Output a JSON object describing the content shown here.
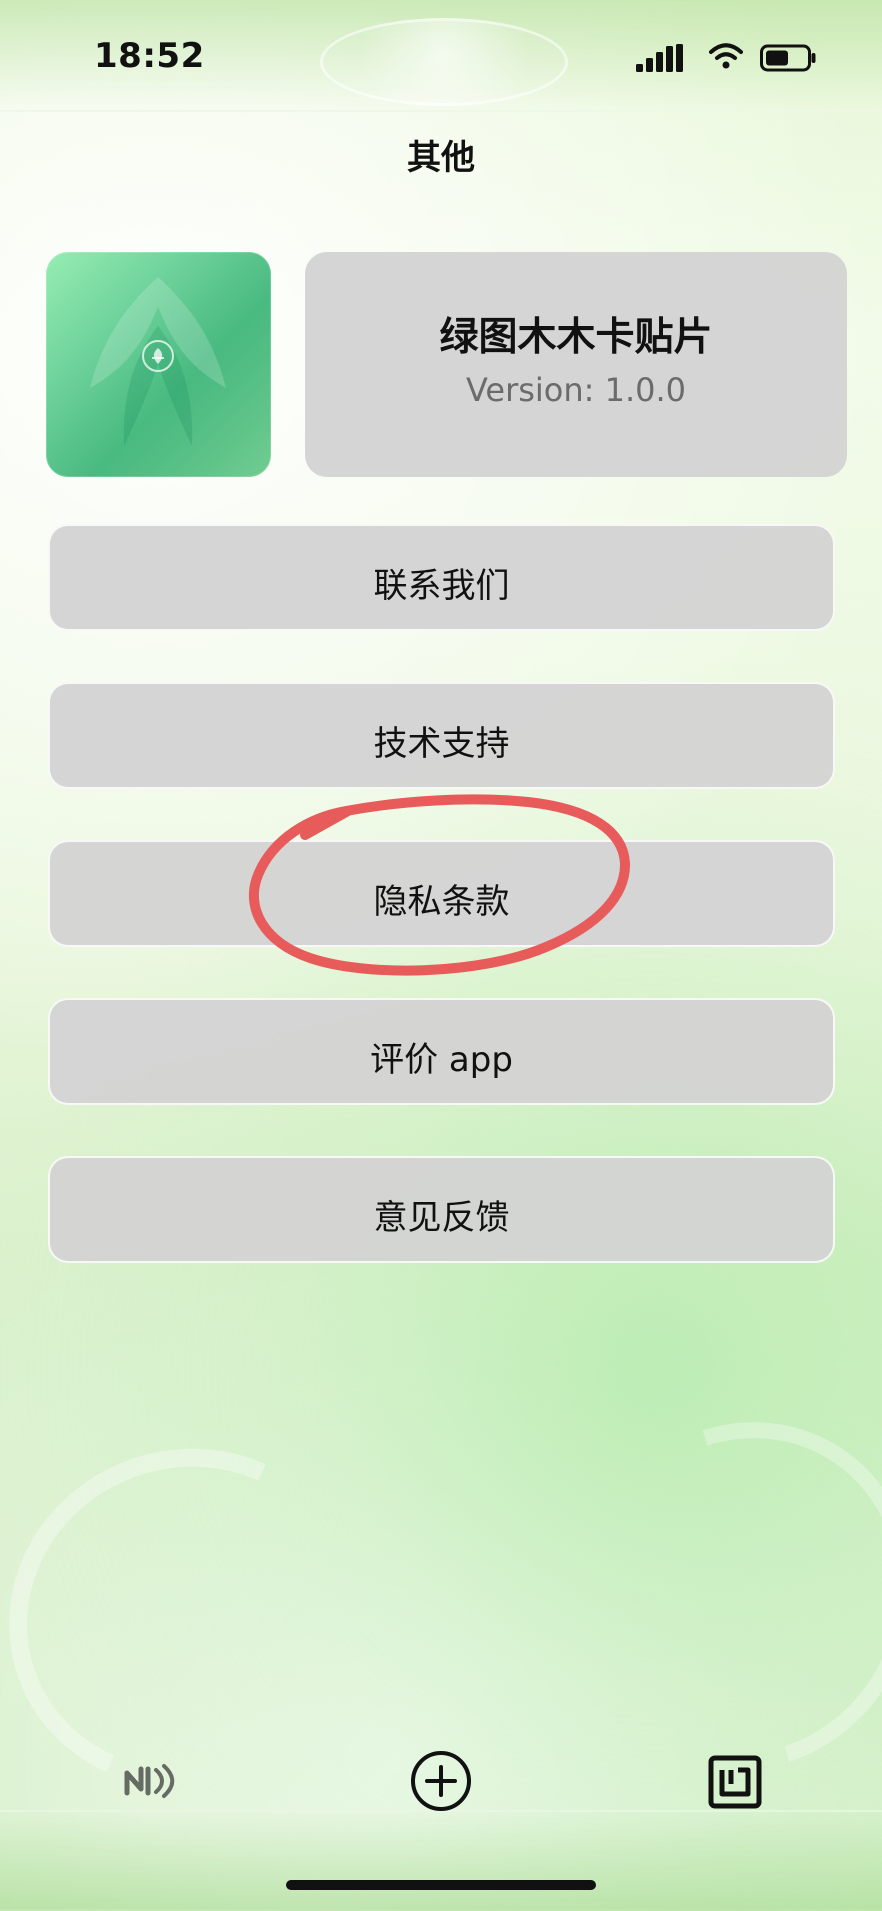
{
  "status_bar": {
    "time": "18:52",
    "icons": [
      "signal-icon",
      "wifi-icon",
      "battery-icon"
    ]
  },
  "navigation": {
    "title": "其他"
  },
  "app_info": {
    "icon_name": "app-logo",
    "name": "绿图木木卡贴片",
    "version": "Version: 1.0.0"
  },
  "menu": {
    "items": [
      {
        "label": "联系我们"
      },
      {
        "label": "技术支持"
      },
      {
        "label": "隐私条款",
        "highlighted": true
      },
      {
        "label": "评价 app"
      },
      {
        "label": "意见反馈"
      }
    ]
  },
  "toolbar": {
    "items": [
      {
        "icon": "nfc-icon"
      },
      {
        "icon": "add-circle-icon"
      },
      {
        "icon": "nfc-tag-icon"
      }
    ]
  },
  "colors": {
    "background": "#e8f7d8",
    "card": "#d3d3d3",
    "text": "#111111",
    "secondary_text": "#6b6b6b",
    "highlight": "#e85b5b",
    "app_icon_green": "#5fd08f"
  }
}
